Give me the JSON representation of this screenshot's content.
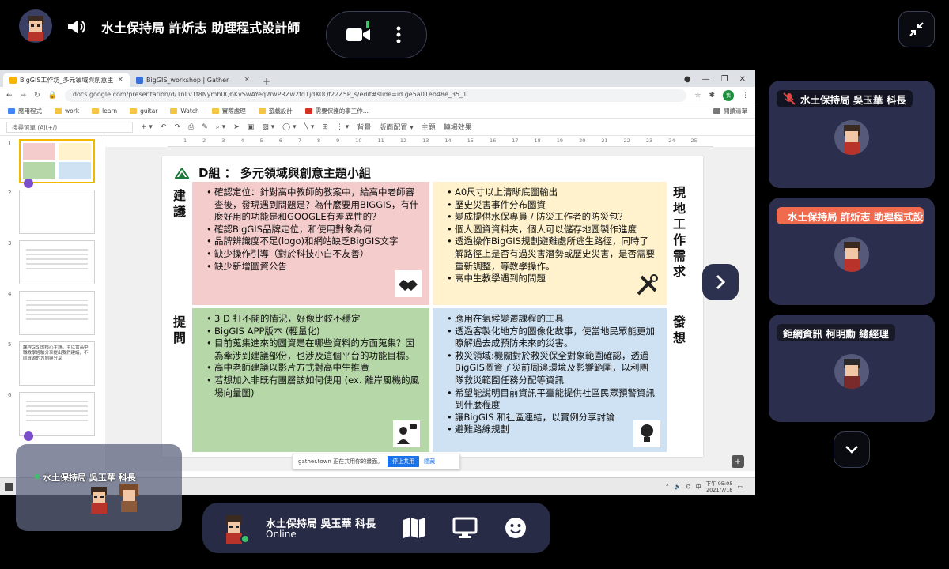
{
  "top": {
    "title": "水土保持局 許炘志 助理程式設計師",
    "mic_color": "#3cc26a"
  },
  "browser": {
    "tabs": [
      {
        "label": "BigGIS工作坊_多元領域與創意主",
        "favicon_color": "#f4b400"
      },
      {
        "label": "BigGIS_workshop | Gather",
        "favicon_color": "#3a6fd8"
      }
    ],
    "url": "docs.google.com/presentation/d/1nLv1f8Nymh0QbKvSwAYeqWwPRZw2fd1jdX0Qf22Z5P_s/edit#slide=id.ge5a01eb48e_35_1",
    "profile_initial": "我",
    "bookmarks": [
      "應用程式",
      "work",
      "learn",
      "guitar",
      "Watch",
      "實際處理",
      "遊戲設計",
      "需要保護的事工作..."
    ],
    "bookmarks_right": "閱讀清單",
    "search_menus": "搜尋選單 (Alt+/)",
    "toolbar_items": [
      "背景",
      "版面配置 ▾",
      "主題",
      "轉場效果"
    ],
    "ruler_ticks": [
      "1",
      "2",
      "3",
      "4",
      "5",
      "6",
      "7",
      "8",
      "9",
      "10",
      "11",
      "12",
      "13",
      "14",
      "15",
      "16",
      "17",
      "18",
      "19",
      "20",
      "21",
      "22",
      "23",
      "24",
      "25"
    ],
    "thumb_numbers": [
      "1",
      "2",
      "3",
      "4",
      "5",
      "6"
    ],
    "thumb5_text": "課程GIS 的核心主題。主以當高中職教學經驗分享提出我們建議，不同資源的方向與分享",
    "notify_text": "gather.town 正在共用你的畫面。",
    "notify_stop": "停止共用",
    "notify_hide": "隱藏",
    "clock_time": "下午 05:05",
    "clock_date": "2021/7/18",
    "tray_lang": "中"
  },
  "slide": {
    "title": "D組 ： 多元領域與創意主題小組",
    "left_label_top": "建議",
    "left_label_bottom": "提問",
    "right_label_top": "現地工作需求",
    "right_label_bottom": "發想",
    "pink_items": [
      "確認定位：針對高中教師的教案中，給高中老師審查後，發現遇到問題是？為什麼要用BIGGIS，有什麼好用的功能是和GOOGLE有差異性的？",
      "確認BigGIS品牌定位，和使用對象為何",
      "品牌辨識度不足(logo)和網站缺乏BigGIS文字",
      "缺少操作引導（對於科技小白不友善）",
      "缺少新增圖資公告"
    ],
    "yellow_items": [
      "A0尺寸以上清晰底圖輸出",
      "歷史災害事件分布圖資",
      "變成提供水保專員 / 防災工作者的防災包？",
      "個人圖資資料夾，個人可以儲存地圖製作進度",
      "透過操作BigGIS規劃避難處所逃生路徑，同時了解路徑上是否有過災害潛勢或歷史災害，是否需要重新調整，等教學操作。",
      "高中生教學遇到的問題"
    ],
    "green_items": [
      "3 D 打不開的情況，好像比較不穩定",
      "BigGIS APP版本 (輕量化)",
      "目前蒐集進來的圖資是在哪些資料的方面蒐集？因為牽涉到建議部份，也涉及這個平台的功能目標。",
      "高中老師建議以影片方式對高中生推廣",
      "若想加入非既有團層該如何使用 (ex. 離岸風機的風場向量圖)"
    ],
    "blue_items": [
      "應用在氣候變遷課程的工具",
      "透過客製化地方的圖像化故事，使當地民眾能更加瞭解過去成預防未來的災害。",
      "救災領域:機關對於救災保全對象範圍確認，透過BigGIS圖資了災前周邊環境及影響範圍，以利團隊救災範圍任務分配等資訊",
      "希望能說明目前資訊平臺能提供社區民眾預警資訊到什麼程度",
      "讓BigGIS 和社區連結，以實例分享討論",
      "避難路線規劃"
    ],
    "colors": {
      "pink": "#f4cccc",
      "yellow": "#fff2cc",
      "green": "#b6d7a8",
      "blue": "#cfe2f3"
    }
  },
  "self_view": {
    "name": "水土保持局 吳玉華 科長"
  },
  "participants": [
    {
      "name": "水土保持局 吳玉華 科長",
      "state": "muted",
      "icon": "mic-off-icon"
    },
    {
      "name": "水土保持局 許炘志 助理程式設計師",
      "state": "speaking",
      "icon": "speaker-icon"
    },
    {
      "name": "鉅網資訊 柯明勳 總經理",
      "state": "normal",
      "icon": ""
    }
  ],
  "bottom_bar": {
    "name": "水土保持局 吳玉華 科長",
    "status": "Online",
    "status_color": "#3cc26a"
  }
}
